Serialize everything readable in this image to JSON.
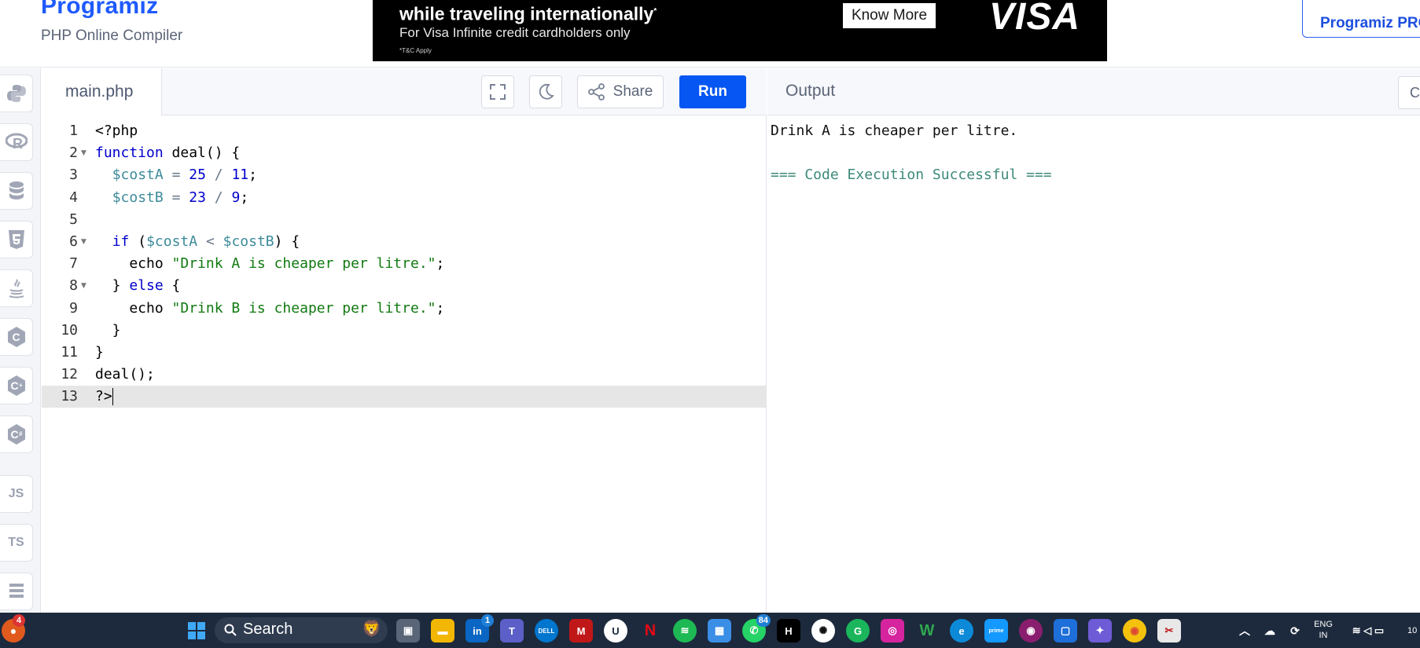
{
  "header": {
    "brand": "Programiz",
    "subtitle": "PHP Online Compiler",
    "pro_button": "Programiz PRO"
  },
  "ad": {
    "headline": "while traveling internationally",
    "subline": "For Visa Infinite credit cardholders only",
    "fine_print": "*T&C Apply",
    "button": "Know More",
    "logo": "VISA"
  },
  "sidebar": {
    "items": [
      {
        "icon": "python-icon",
        "label": "Py"
      },
      {
        "icon": "r-icon",
        "label": "R"
      },
      {
        "icon": "sql-icon",
        "label": ""
      },
      {
        "icon": "html-icon",
        "label": "5"
      },
      {
        "icon": "java-icon",
        "label": ""
      },
      {
        "icon": "c-icon",
        "label": "C"
      },
      {
        "icon": "cpp-icon",
        "label": "C"
      },
      {
        "icon": "csharp-icon",
        "label": "C"
      },
      {
        "icon": "js-icon",
        "label": "JS"
      },
      {
        "icon": "ts-icon",
        "label": "TS"
      },
      {
        "icon": "go-icon",
        "label": ""
      }
    ]
  },
  "editor": {
    "file_name": "main.php",
    "share_label": "Share",
    "run_label": "Run",
    "lines": [
      {
        "n": "1",
        "fold": false,
        "html": "<?php"
      },
      {
        "n": "2",
        "fold": true,
        "html": "function deal() {"
      },
      {
        "n": "3",
        "fold": false,
        "html": "  $costA = 25 / 11;"
      },
      {
        "n": "4",
        "fold": false,
        "html": "  $costB = 23 / 9;"
      },
      {
        "n": "5",
        "fold": false,
        "html": ""
      },
      {
        "n": "6",
        "fold": true,
        "html": "  if ($costA < $costB) {"
      },
      {
        "n": "7",
        "fold": false,
        "html": "    echo \"Drink A is cheaper per litre.\";"
      },
      {
        "n": "8",
        "fold": true,
        "html": "  } else {"
      },
      {
        "n": "9",
        "fold": false,
        "html": "    echo \"Drink B is cheaper per litre.\";"
      },
      {
        "n": "10",
        "fold": false,
        "html": "  }"
      },
      {
        "n": "11",
        "fold": false,
        "html": "}"
      },
      {
        "n": "12",
        "fold": false,
        "html": "deal();"
      },
      {
        "n": "13",
        "fold": false,
        "html": "?>"
      }
    ]
  },
  "output": {
    "title": "Output",
    "clear_label": "Clear",
    "lines": [
      {
        "text": "Drink A is cheaper per litre.",
        "color": "#111111"
      },
      {
        "text": "",
        "color": "#111111"
      },
      {
        "text": "=== Code Execution Successful ===",
        "color": "#3d8a7a"
      }
    ]
  },
  "taskbar": {
    "search_label": "Search",
    "notification_count": "4",
    "linkedin_badge": "1",
    "whatsapp_badge": "84",
    "language": "ENG",
    "region": "IN",
    "clock_partial": "10"
  }
}
